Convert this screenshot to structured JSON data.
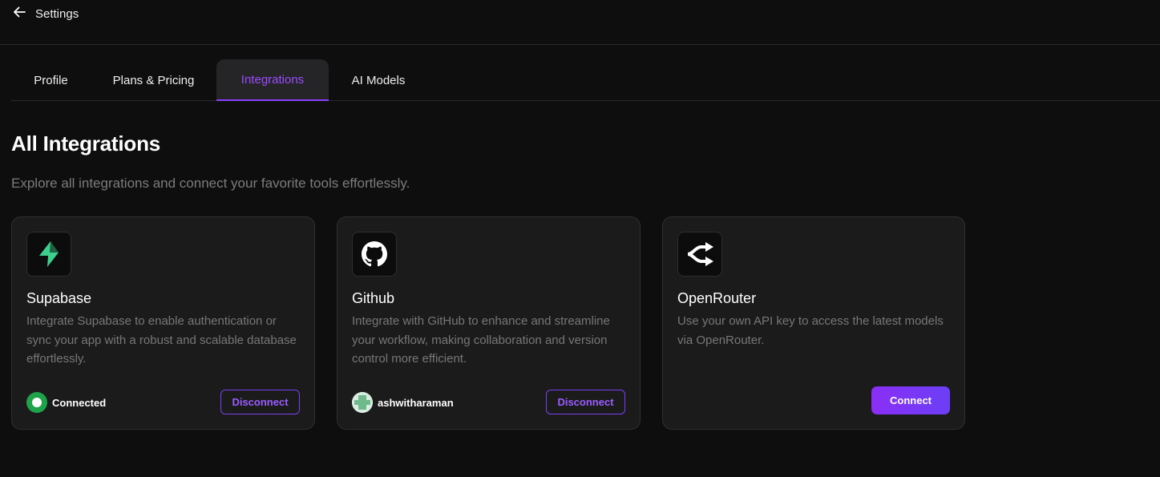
{
  "header": {
    "back_icon": "arrow-left-icon",
    "title": "Settings"
  },
  "tabs": [
    {
      "label": "Profile",
      "active": false
    },
    {
      "label": "Plans & Pricing",
      "active": false
    },
    {
      "label": "Integrations",
      "active": true
    },
    {
      "label": "AI Models",
      "active": false
    }
  ],
  "section": {
    "title": "All Integrations",
    "subtitle": "Explore all integrations and connect your favorite tools effortlessly."
  },
  "integrations": [
    {
      "name": "Supabase",
      "icon": "supabase-logo-icon",
      "description": "Integrate Supabase to enable authentication or sync your app with a robust and scalable database effortlessly.",
      "status": "Connected",
      "action": "Disconnect"
    },
    {
      "name": "Github",
      "icon": "github-logo-icon",
      "description": "Integrate with GitHub to enhance and streamline your workflow, making collaboration and version control more efficient.",
      "username": "ashwitharaman",
      "action": "Disconnect"
    },
    {
      "name": "OpenRouter",
      "icon": "openrouter-logo-icon",
      "description": "Use your own API key to access the latest models via OpenRouter.",
      "action": "Connect"
    }
  ],
  "colors": {
    "background": "#0f0e0f",
    "card": "#1b1b1c",
    "accent": "#8a3ffc",
    "connected": "#1fa34a",
    "supabase_green": "#3ecf8e"
  }
}
